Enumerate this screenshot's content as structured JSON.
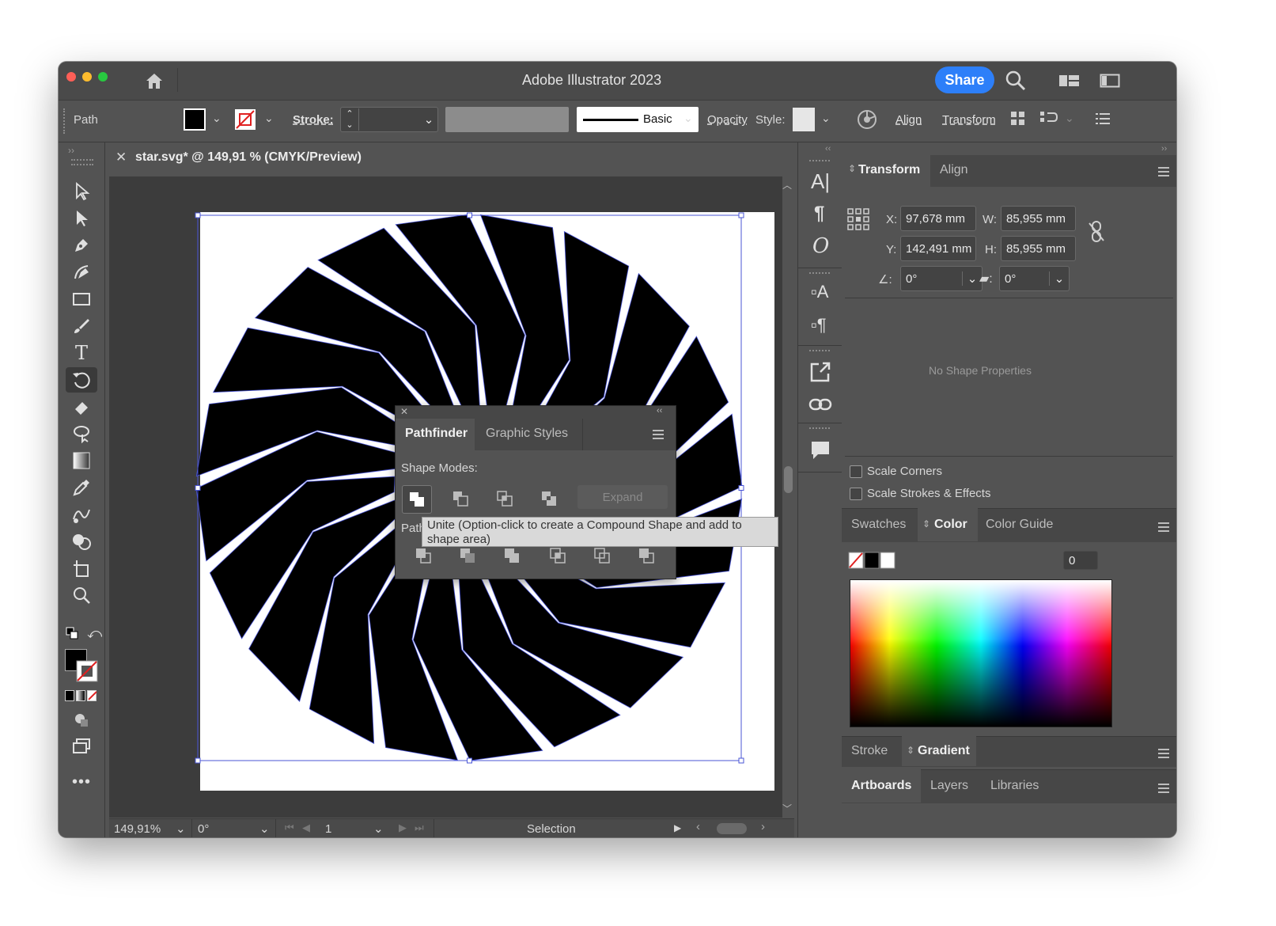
{
  "window": {
    "title": "Adobe Illustrator 2023",
    "share_label": "Share"
  },
  "control_bar": {
    "selection_type": "Path",
    "stroke_label": "Stroke:",
    "brush_label": "Basic",
    "opacity_label": "Opacity",
    "style_label": "Style:",
    "align_label": "Align",
    "transform_label": "Transform"
  },
  "document": {
    "tab_title": "star.svg* @ 149,91 % (CMYK/Preview)"
  },
  "status_bar": {
    "zoom": "149,91%",
    "rotation": "0°",
    "artboard_number": "1",
    "current_tool": "Selection"
  },
  "transform_panel": {
    "tabs": [
      "Transform",
      "Align"
    ],
    "x_label": "X:",
    "x_value": "97,678 mm",
    "y_label": "Y:",
    "y_value": "142,491 mm",
    "w_label": "W:",
    "w_value": "85,955 mm",
    "h_label": "H:",
    "h_value": "85,955 mm",
    "rotate_value": "0°",
    "shear_value": "0°",
    "no_shape_text": "No Shape Properties",
    "scale_corners": "Scale Corners",
    "scale_strokes": "Scale Strokes & Effects"
  },
  "color_panel": {
    "tabs": [
      "Swatches",
      "Color",
      "Color Guide"
    ],
    "value": "0"
  },
  "stroke_gradient_panel": {
    "tabs": [
      "Stroke",
      "Gradient"
    ]
  },
  "artboards_panel": {
    "tabs": [
      "Artboards",
      "Layers",
      "Libraries"
    ]
  },
  "pathfinder": {
    "tabs": [
      "Pathfinder",
      "Graphic Styles"
    ],
    "shape_modes_label": "Shape Modes:",
    "expand_label": "Expand",
    "pathfinders_label_visible": "Path",
    "tooltip": "Unite (Option-click to create a Compound Shape and add to shape area)"
  },
  "colors": {
    "accent": "#2d7ff9",
    "panel": "#535353",
    "dark": "#3c3c3c",
    "selection": "#4a55d6"
  }
}
